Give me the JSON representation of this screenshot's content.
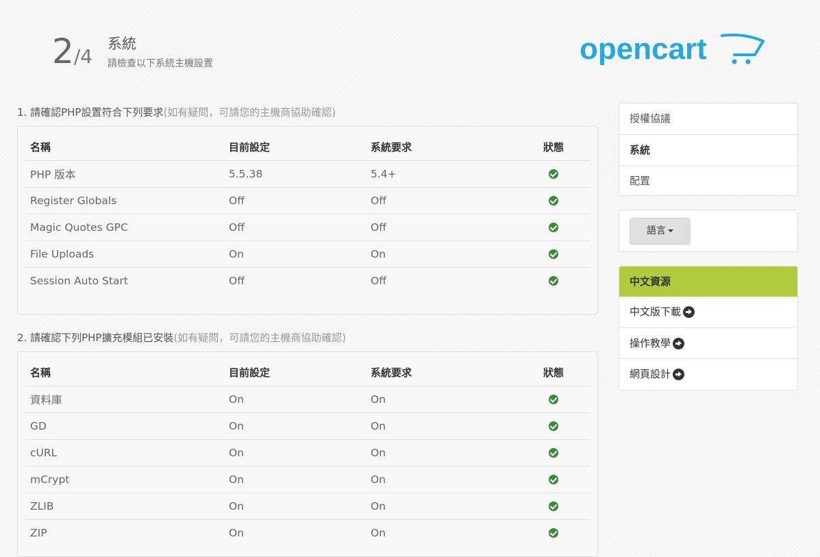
{
  "header": {
    "step_current": "2",
    "step_total": "/4",
    "title": "系統",
    "subtitle": "請檢查以下系統主機設置",
    "logo_text": "opencart"
  },
  "section1": {
    "title": "1. 請確認PHP設置符合下列要求",
    "hint": "(如有疑問，可請您的主機商協助確認)",
    "columns": [
      "名稱",
      "目前設定",
      "系統要求",
      "狀態"
    ],
    "rows": [
      {
        "name": "PHP 版本",
        "current": "5.5.38",
        "required": "5.4+",
        "status": "ok"
      },
      {
        "name": "Register Globals",
        "current": "Off",
        "required": "Off",
        "status": "ok"
      },
      {
        "name": "Magic Quotes GPC",
        "current": "Off",
        "required": "Off",
        "status": "ok"
      },
      {
        "name": "File Uploads",
        "current": "On",
        "required": "On",
        "status": "ok"
      },
      {
        "name": "Session Auto Start",
        "current": "Off",
        "required": "Off",
        "status": "ok"
      }
    ]
  },
  "section2": {
    "title": "2. 請確認下列PHP擴充模組已安裝",
    "hint": "(如有疑問，可請您的主機商協助確認)",
    "columns": [
      "名稱",
      "目前設定",
      "系統要求",
      "狀態"
    ],
    "rows": [
      {
        "name": "資料庫",
        "current": "On",
        "required": "On",
        "status": "ok"
      },
      {
        "name": "GD",
        "current": "On",
        "required": "On",
        "status": "ok"
      },
      {
        "name": "cURL",
        "current": "On",
        "required": "On",
        "status": "ok"
      },
      {
        "name": "mCrypt",
        "current": "On",
        "required": "On",
        "status": "ok"
      },
      {
        "name": "ZLIB",
        "current": "On",
        "required": "On",
        "status": "ok"
      },
      {
        "name": "ZIP",
        "current": "On",
        "required": "On",
        "status": "ok"
      }
    ]
  },
  "sidebar": {
    "steps": [
      {
        "label": "授權協議",
        "active": false
      },
      {
        "label": "系統",
        "active": true
      },
      {
        "label": "配置",
        "active": false
      }
    ],
    "language_button": "語言",
    "resources_title": "中文資源",
    "resources": [
      {
        "label": "中文版下載"
      },
      {
        "label": "操作教學"
      },
      {
        "label": "網頁設計"
      }
    ]
  },
  "colors": {
    "accent_green": "#b1cb3c",
    "status_ok": "#3c8a3c",
    "logo_blue": "#23a8e0"
  }
}
